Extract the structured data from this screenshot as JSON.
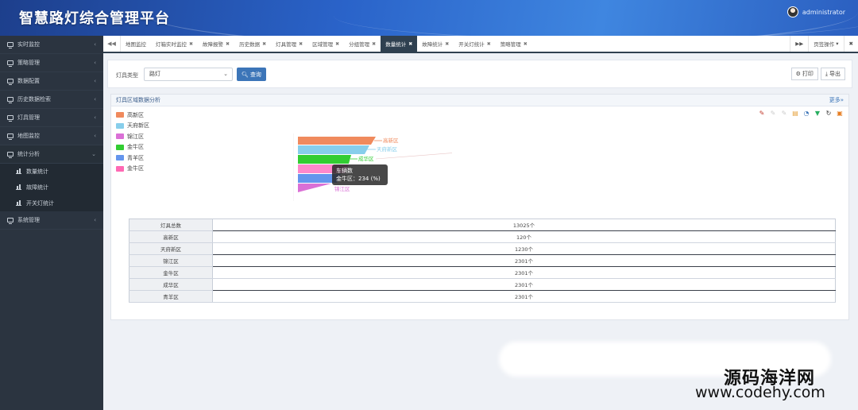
{
  "app": {
    "title": "智慧路灯综合管理平台",
    "username": "administrator"
  },
  "sidebar": {
    "items": [
      {
        "label": "实时监控",
        "open": false
      },
      {
        "label": "策略管理",
        "open": false
      },
      {
        "label": "数据配置",
        "open": false
      },
      {
        "label": "历史数据检索",
        "open": false
      },
      {
        "label": "灯具管理",
        "open": false
      },
      {
        "label": "地图监控",
        "open": false
      },
      {
        "label": "统计分析",
        "open": true
      },
      {
        "label": "系统管理",
        "open": false
      }
    ],
    "subitems": [
      {
        "label": "数量统计"
      },
      {
        "label": "故障统计"
      },
      {
        "label": "开关灯统计"
      }
    ]
  },
  "tabs": {
    "items": [
      {
        "label": "地图监控",
        "closable": false,
        "active": false
      },
      {
        "label": "灯箱实时监控",
        "closable": true,
        "active": false
      },
      {
        "label": "故障报警",
        "closable": true,
        "active": false
      },
      {
        "label": "历史数据",
        "closable": true,
        "active": false
      },
      {
        "label": "灯具管理",
        "closable": true,
        "active": false
      },
      {
        "label": "区域管理",
        "closable": true,
        "active": false
      },
      {
        "label": "分组管理",
        "closable": true,
        "active": false
      },
      {
        "label": "数量统计",
        "closable": true,
        "active": true
      },
      {
        "label": "故障统计",
        "closable": true,
        "active": false
      },
      {
        "label": "开关灯统计",
        "closable": true,
        "active": false
      },
      {
        "label": "策略管理",
        "closable": true,
        "active": false
      }
    ],
    "page_ops": "页签操作"
  },
  "toolbar": {
    "type_label": "灯具类型",
    "type_value": "路灯",
    "query_label": "查询",
    "print_label": "打印",
    "export_label": "导出"
  },
  "panel": {
    "title": "灯具区域数据分析",
    "more": "更多»"
  },
  "chart_data": {
    "type": "funnel",
    "legend": [
      {
        "name": "高新区",
        "color": "#f08a5d"
      },
      {
        "name": "天府新区",
        "color": "#87ceeb"
      },
      {
        "name": "锦江区",
        "color": "#da70d6"
      },
      {
        "name": "金牛区",
        "color": "#32cd32"
      },
      {
        "name": "青羊区",
        "color": "#6495ed"
      },
      {
        "name": "金牛区",
        "color": "#ff69b4"
      }
    ],
    "labels": [
      "高新区",
      "天府新区",
      "成华区",
      "锦江区"
    ],
    "tooltip": {
      "title": "车辆数",
      "line": "金牛区：234 (%)"
    }
  },
  "table": {
    "rows": [
      {
        "label": "灯具总数",
        "value": "13025个"
      },
      {
        "label": "高新区",
        "value": "120个"
      },
      {
        "label": "天府新区",
        "value": "1230个"
      },
      {
        "label": "锦江区",
        "value": "2301个"
      },
      {
        "label": "金牛区",
        "value": "2301个"
      },
      {
        "label": "成华区",
        "value": "2301个"
      },
      {
        "label": "青羊区",
        "value": "2301个"
      }
    ]
  },
  "watermark": {
    "line1": "源码海洋网",
    "line2": "www.codehy.com"
  }
}
